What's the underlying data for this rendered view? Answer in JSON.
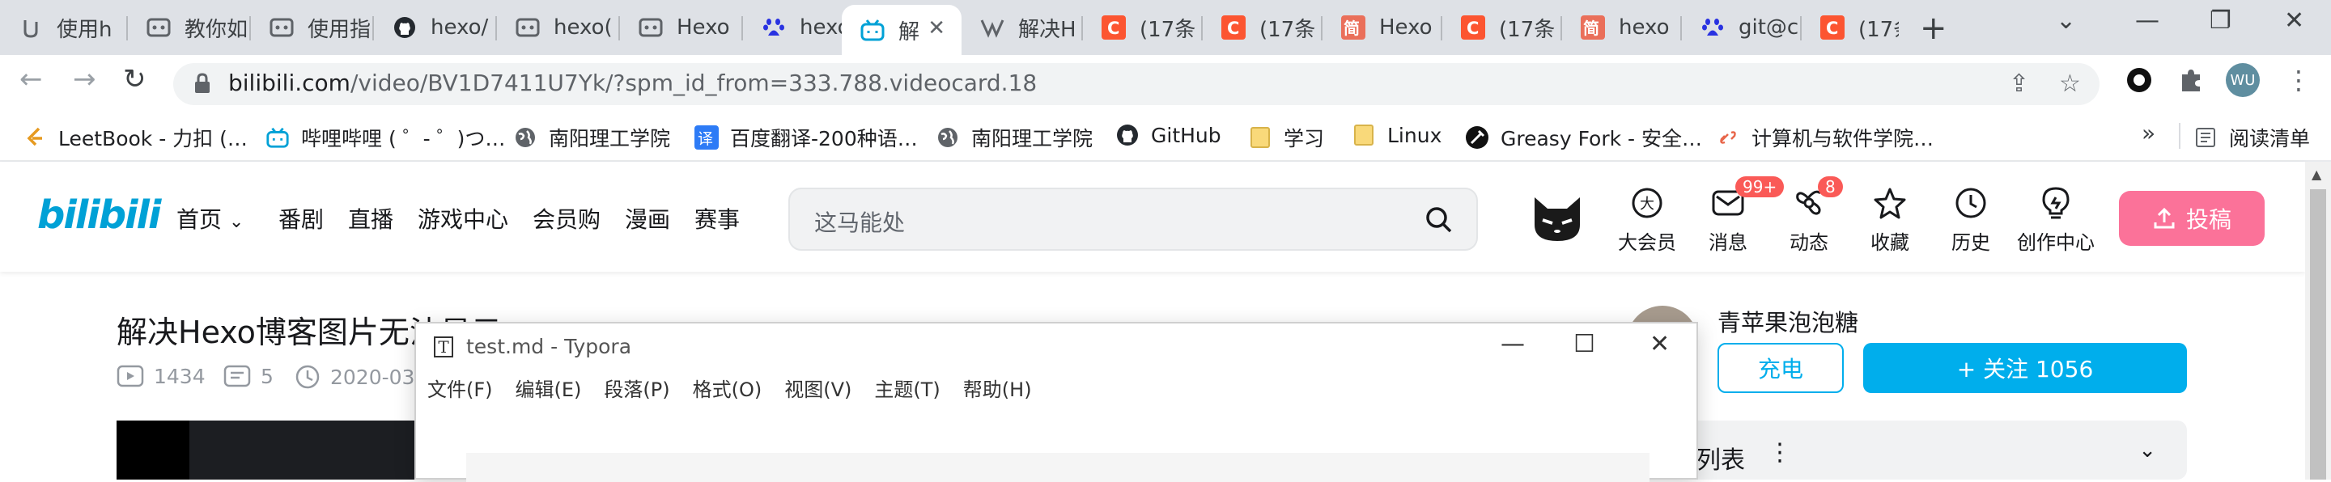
{
  "browser": {
    "tabs": [
      {
        "label": "使用h",
        "icon": "page-icon"
      },
      {
        "label": "教你如",
        "icon": "page-icon"
      },
      {
        "label": "使用指",
        "icon": "page-icon"
      },
      {
        "label": "hexo/",
        "icon": "github-icon"
      },
      {
        "label": "hexo(",
        "icon": "page-icon"
      },
      {
        "label": "Hexo",
        "icon": "page-icon"
      },
      {
        "label": "hexo",
        "icon": "baidu-paw-icon"
      },
      {
        "label": "解",
        "icon": "bilibili-tv-icon",
        "active": true
      },
      {
        "label": "解决H",
        "icon": "page-icon"
      },
      {
        "label": "(17条",
        "icon": "csdn-icon"
      },
      {
        "label": "(17条",
        "icon": "csdn-icon"
      },
      {
        "label": "Hexo",
        "icon": "jianshu-icon"
      },
      {
        "label": "(17条",
        "icon": "csdn-icon"
      },
      {
        "label": "hexo",
        "icon": "jianshu-icon"
      },
      {
        "label": "git@c",
        "icon": "baidu-paw-icon"
      },
      {
        "label": "(17条",
        "icon": "csdn-icon"
      }
    ],
    "url_host": "bilibili.com",
    "url_path": "/video/BV1D7411U7Yk/?spm_id_from=333.788.videocard.18",
    "profile_initials": "WU",
    "bookmarks": [
      {
        "label": "LeetBook - 力扣 (…",
        "icon": "leetcode-icon"
      },
      {
        "label": "哔哩哔哩 ( ゜- ゜)つ…",
        "icon": "bilibili-tv-icon"
      },
      {
        "label": "南阳理工学院",
        "icon": "globe-icon"
      },
      {
        "label": "百度翻译-200种语…",
        "icon": "translate-icon"
      },
      {
        "label": "南阳理工学院",
        "icon": "globe-icon"
      },
      {
        "label": "GitHub",
        "icon": "github-icon"
      },
      {
        "label": "学习",
        "icon": "folder-icon"
      },
      {
        "label": "Linux",
        "icon": "folder-icon"
      },
      {
        "label": "Greasy Fork - 安全…",
        "icon": "greasyfork-icon"
      },
      {
        "label": "计算机与软件学院…",
        "icon": "link-icon"
      }
    ],
    "overflow": "»",
    "reading_list": "阅读清单"
  },
  "bili": {
    "logo": "bilibili",
    "nav": [
      "首页",
      "番剧",
      "直播",
      "游戏中心",
      "会员购",
      "漫画",
      "赛事"
    ],
    "search_placeholder": "这马能处",
    "header_icons": [
      {
        "label": "大会员",
        "icon": "vip-icon"
      },
      {
        "label": "消息",
        "icon": "message-icon",
        "badge": "99+"
      },
      {
        "label": "动态",
        "icon": "dynamic-icon",
        "badge": "8"
      },
      {
        "label": "收藏",
        "icon": "star-icon"
      },
      {
        "label": "历史",
        "icon": "history-icon"
      },
      {
        "label": "创作中心",
        "icon": "bulb-icon"
      }
    ],
    "upload_label": "投稿",
    "video_title": "解决Hexo博客图片无法显示",
    "views": "1434",
    "danmaku": "5",
    "date": "2020-03",
    "up_name": "青苹果泡泡糖",
    "charge_label": "充电",
    "follow_label": "+ 关注 1056",
    "playlist_label": "列表",
    "playlist_more": "⋮",
    "playlist_chevron": "⌄",
    "colors": {
      "brand_blue": "#00aeec",
      "brand_pink": "#fb7299",
      "badge_red": "#fa5a57"
    }
  },
  "typora": {
    "title": "test.md - Typora",
    "menu": [
      "文件(F)",
      "编辑(E)",
      "段落(P)",
      "格式(O)",
      "视图(V)",
      "主题(T)",
      "帮助(H)"
    ]
  }
}
